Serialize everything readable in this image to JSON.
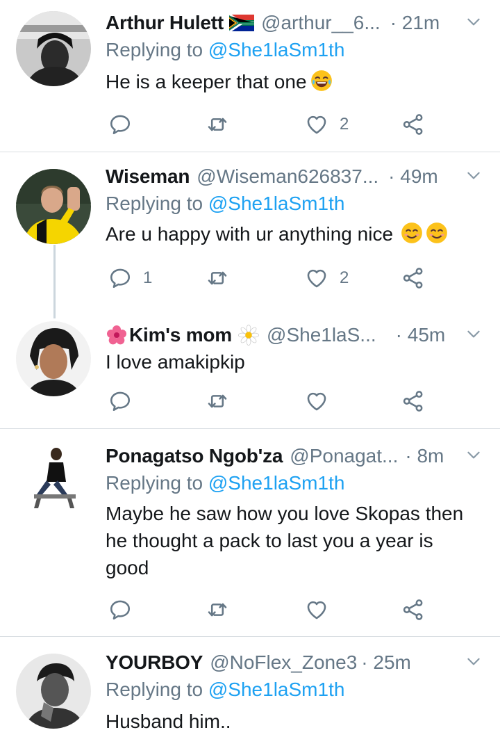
{
  "tweets": [
    {
      "name": "Arthur Hulett",
      "handle": "@arthur__6...",
      "time": "· 21m",
      "reply_prefix": "Replying to ",
      "reply_to": "@She1laSm1th",
      "text": "He is a keeper that one",
      "reply_count": "",
      "like_count": "2"
    },
    {
      "name": "Wiseman",
      "handle": "@Wiseman626837...",
      "time": "· 49m",
      "reply_prefix": "Replying to ",
      "reply_to": "@She1laSm1th",
      "text": "Are u happy with ur anything nice",
      "reply_count": "1",
      "like_count": "2"
    },
    {
      "name": "Kim's mom",
      "handle": "@She1laS...",
      "time": "· 45m",
      "text": "I love amakipkip",
      "reply_count": "",
      "like_count": ""
    },
    {
      "name": "Ponagatso Ngob'za",
      "handle": "@Ponagat...",
      "time": "· 8m",
      "reply_prefix": "Replying to ",
      "reply_to": "@She1laSm1th",
      "text_lines": [
        "Maybe he saw how you love Skopas then",
        "he thought a pack to last you a year is",
        "good"
      ],
      "reply_count": "",
      "like_count": ""
    },
    {
      "name": "YOURBOY",
      "handle": "@NoFlex_Zone3",
      "time": "· 25m",
      "reply_prefix": "Replying to ",
      "reply_to": "@She1laSm1th",
      "text": "Husband him.."
    }
  ],
  "icons": {
    "reply": "reply-icon",
    "retweet": "retweet-icon",
    "like": "heart-icon",
    "share": "share-icon",
    "more": "chevron-down-icon"
  },
  "colors": {
    "mention": "#1da1f2",
    "muted": "#657786",
    "text": "#14171a",
    "divider": "#d8dde2"
  }
}
